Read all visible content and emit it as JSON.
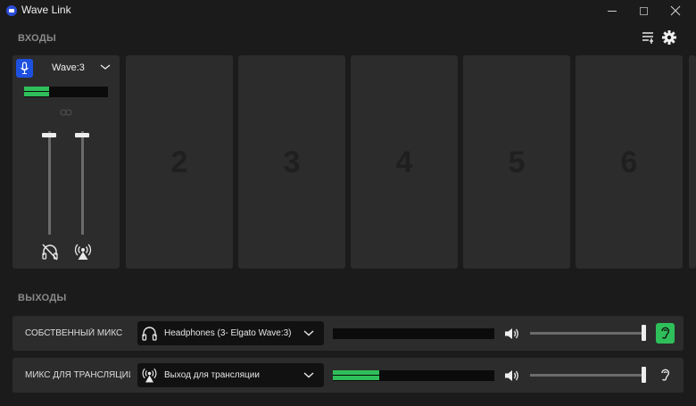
{
  "window": {
    "title": "Wave Link",
    "logo_icon": "elgato-wave-logo-icon",
    "controls": [
      "minimize-icon",
      "maximize-icon",
      "close-icon"
    ]
  },
  "inputs": {
    "section_label": "ВХОДЫ",
    "toolbar_icons": [
      "mixer-settings-icon",
      "gear-icon"
    ],
    "channel": {
      "device": "Wave:3",
      "icon": "microphone-icon",
      "accent": "#1e50e0",
      "level_meter": {
        "top": 0.3,
        "bottom": 0.3
      },
      "monitor_level": 0.98,
      "stream_level": 0.98,
      "monitor_icon": "headphones-muted-icon",
      "stream_icon": "broadcast-icon",
      "link_icon": "link-icon"
    },
    "empty_slots": [
      "2",
      "3",
      "4",
      "5",
      "6"
    ]
  },
  "outputs": {
    "section_label": "ВЫХОДЫ",
    "rows": [
      {
        "label": "СОБСТВЕННЫЙ МИКС",
        "device": "Headphones (3- Elgato Wave:3)",
        "device_icon": "headphones-icon",
        "meter": {
          "top": 0,
          "bottom": 0
        },
        "volume": 1.0,
        "listen_active": true,
        "listen_icon": "ear-icon"
      },
      {
        "label": "МИКС ДЛЯ ТРАНСЛЯЦИИ",
        "device": "Выход для трансляции",
        "device_icon": "broadcast-icon",
        "meter": {
          "top": 0.29,
          "bottom": 0.29
        },
        "volume": 1.0,
        "listen_active": false,
        "listen_icon": "ear-icon"
      }
    ]
  },
  "colors": {
    "accent_blue": "#1e50e0",
    "meter_green": "#2fbf5a",
    "active_green": "#2fbf5a"
  }
}
